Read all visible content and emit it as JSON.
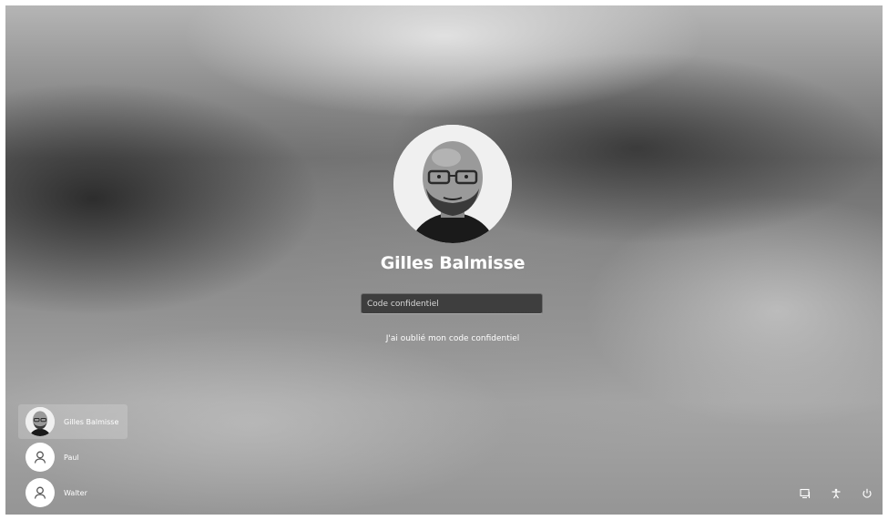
{
  "login": {
    "user_name": "Gilles Balmisse",
    "pin_placeholder": "Code confidentiel",
    "forgot_pin_label": "J'ai oublié mon code confidentiel"
  },
  "user_list": [
    {
      "name": "Gilles Balmisse",
      "selected": true,
      "avatar": "photo"
    },
    {
      "name": "Paul",
      "selected": false,
      "avatar": "default-user-icon"
    },
    {
      "name": "Walter",
      "selected": false,
      "avatar": "default-user-icon"
    }
  ],
  "tray": {
    "icons": [
      "network-icon",
      "accessibility-icon",
      "power-icon"
    ]
  },
  "colors": {
    "text": "#ffffff",
    "input_background": "#1e1e1e"
  }
}
